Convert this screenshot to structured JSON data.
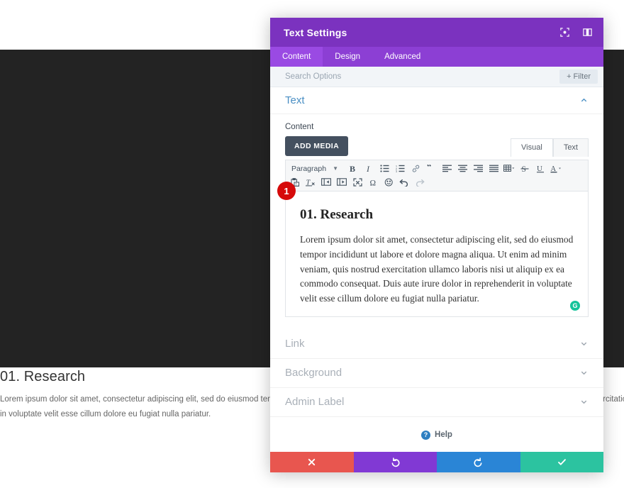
{
  "page": {
    "heading": "01. Research",
    "paragraph_line1": "Lorem ipsum dolor sit amet, consectetur adipiscing elit, sed do eiusmod tempor incididunt ut labore et dolore magna aliqua. Ut enim ad minim veniam, quis nostrud exercitation ullamco laboris nisi ut a",
    "paragraph_line2": "in voluptate velit esse cillum dolore eu fugiat nulla pariatur."
  },
  "modal": {
    "title": "Text Settings",
    "header_icons": [
      {
        "name": "focus-icon"
      },
      {
        "name": "panel-layout-icon"
      }
    ],
    "tabs": [
      {
        "label": "Content",
        "active": true
      },
      {
        "label": "Design",
        "active": false
      },
      {
        "label": "Advanced",
        "active": false
      }
    ],
    "search": {
      "placeholder": "Search Options",
      "value": "",
      "filter_label": "+ Filter"
    },
    "sections": [
      {
        "label": "Text",
        "open": true
      },
      {
        "label": "Link",
        "open": false
      },
      {
        "label": "Background",
        "open": false
      },
      {
        "label": "Admin Label",
        "open": false
      }
    ],
    "content_section": {
      "field_label": "Content",
      "add_media_label": "ADD MEDIA",
      "editor_tabs": [
        {
          "label": "Visual",
          "active": true
        },
        {
          "label": "Text",
          "active": false
        }
      ],
      "format_select": "Paragraph",
      "toolbar_row1": [
        "bold-icon",
        "italic-icon",
        "bullet-list-icon",
        "numbered-list-icon",
        "link-icon",
        "blockquote-icon",
        "align-left-icon",
        "align-center-icon",
        "align-right-icon",
        "align-justify-icon",
        "table-icon",
        "strikethrough-icon",
        "underline-icon",
        "text-color-icon"
      ],
      "toolbar_row2": [
        "paste-as-text-icon",
        "clear-formatting-icon",
        "outdent-icon",
        "indent-icon",
        "fullscreen-icon",
        "special-character-icon",
        "emoji-icon",
        "undo-icon",
        "redo-icon"
      ],
      "marker_badge": "1",
      "editor_heading": "01. Research",
      "editor_paragraph": "Lorem ipsum dolor sit amet, consectetur adipiscing elit, sed do eiusmod tempor incididunt ut labore et dolore magna aliqua. Ut enim ad minim veniam, quis nostrud exercitation ullamco laboris nisi ut aliquip ex ea commodo consequat. Duis aute irure dolor in reprehenderit in voluptate velit esse cillum dolore eu fugiat nulla pariatur.",
      "grammarly_icon_label": "G"
    },
    "help": {
      "label": "Help",
      "icon": "?"
    },
    "footer_buttons": [
      {
        "name": "cancel-button",
        "glyph": "✕"
      },
      {
        "name": "undo-button",
        "glyph": "↺"
      },
      {
        "name": "redo-button",
        "glyph": "↻"
      },
      {
        "name": "save-button",
        "glyph": "✓"
      }
    ]
  },
  "colors": {
    "header_purple": "#7b32bf",
    "tabbar_purple": "#8c3fd4",
    "cancel_red": "#e8564f",
    "undo_purple": "#8139d4",
    "redo_blue": "#2a85d6",
    "save_green": "#2cc3a0",
    "badge_red": "#d60a0a",
    "grammarly_green": "#15c39a"
  }
}
